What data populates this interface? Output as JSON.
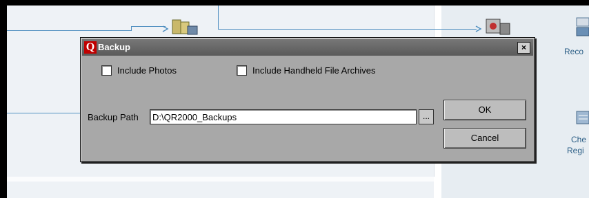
{
  "dialog": {
    "title": "Backup",
    "logo_letter": "Q",
    "close_label": "×",
    "include_photos_label": "Include Photos",
    "include_photos_checked": false,
    "include_archives_label": "Include Handheld File Archives",
    "include_archives_checked": false,
    "path_label": "Backup Path",
    "path_value": "D:\\QR2000_Backups",
    "browse_label": "...",
    "ok_label": "OK",
    "cancel_label": "Cancel"
  },
  "background": {
    "right_panel_labels": [
      "Reco",
      "Che",
      "Regi"
    ]
  },
  "colors": {
    "dialog_bg": "#a8a8a8",
    "titlebar": "#5a5a5a",
    "logo_red": "#c00000",
    "connector_blue": "#4f8fc0"
  }
}
